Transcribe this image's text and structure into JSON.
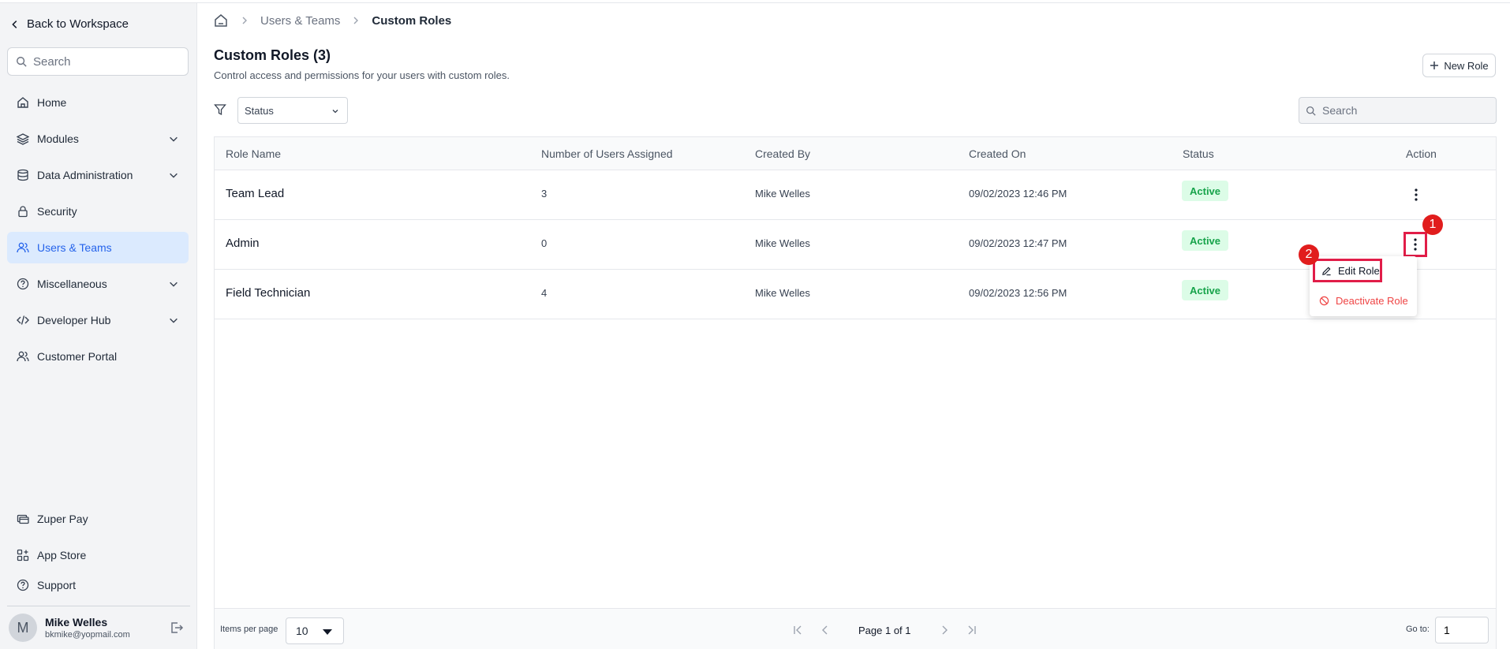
{
  "sidebar": {
    "back_label": "Back to Workspace",
    "search_placeholder": "Search",
    "items": [
      {
        "label": "Home",
        "icon": "home-icon"
      },
      {
        "label": "Modules",
        "icon": "layers-icon"
      },
      {
        "label": "Data Administration",
        "icon": "database-icon"
      },
      {
        "label": "Security",
        "icon": "lock-icon"
      },
      {
        "label": "Users & Teams",
        "icon": "users-icon"
      },
      {
        "label": "Miscellaneous",
        "icon": "help-circle-icon"
      },
      {
        "label": "Developer Hub",
        "icon": "code-icon"
      },
      {
        "label": "Customer Portal",
        "icon": "users-icon"
      }
    ],
    "bottom_items": [
      {
        "label": "Zuper Pay",
        "icon": "card-icon"
      },
      {
        "label": "App Store",
        "icon": "apps-icon"
      },
      {
        "label": "Support",
        "icon": "help-circle-icon"
      }
    ],
    "user": {
      "initial": "M",
      "name": "Mike Welles",
      "email": "bkmike@yopmail.com"
    }
  },
  "breadcrumb": {
    "parent": "Users & Teams",
    "current": "Custom Roles"
  },
  "page": {
    "title": "Custom Roles (3)",
    "subtitle": "Control access and permissions for your users with custom roles.",
    "new_role_label": "New Role",
    "status_filter": "Status",
    "search_placeholder": "Search"
  },
  "table": {
    "headers": [
      "Role Name",
      "Number of Users Assigned",
      "Created By",
      "Created On",
      "Status",
      "Action"
    ],
    "rows": [
      {
        "name": "Team Lead",
        "users": "3",
        "created_by": "Mike Welles",
        "created_on": "09/02/2023 12:46 PM",
        "status": "Active"
      },
      {
        "name": "Admin",
        "users": "0",
        "created_by": "Mike Welles",
        "created_on": "09/02/2023 12:47 PM",
        "status": "Active"
      },
      {
        "name": "Field Technician",
        "users": "4",
        "created_by": "Mike Welles",
        "created_on": "09/02/2023 12:56 PM",
        "status": "Active"
      }
    ]
  },
  "context_menu": {
    "edit_label": "Edit Role",
    "deactivate_label": "Deactivate Role"
  },
  "markers": {
    "first": "1",
    "second": "2"
  },
  "footer": {
    "items_per_page_label": "Items per page",
    "items_per_page": "10",
    "page_text": "Page 1 of 1",
    "goto_label": "Go to:",
    "goto_value": "1"
  },
  "colors": {
    "accent": "#2563eb",
    "active_badge_bg": "#dcfce7",
    "active_badge_text": "#16a34a",
    "danger": "#ef4444",
    "highlight": "#e11d48"
  }
}
